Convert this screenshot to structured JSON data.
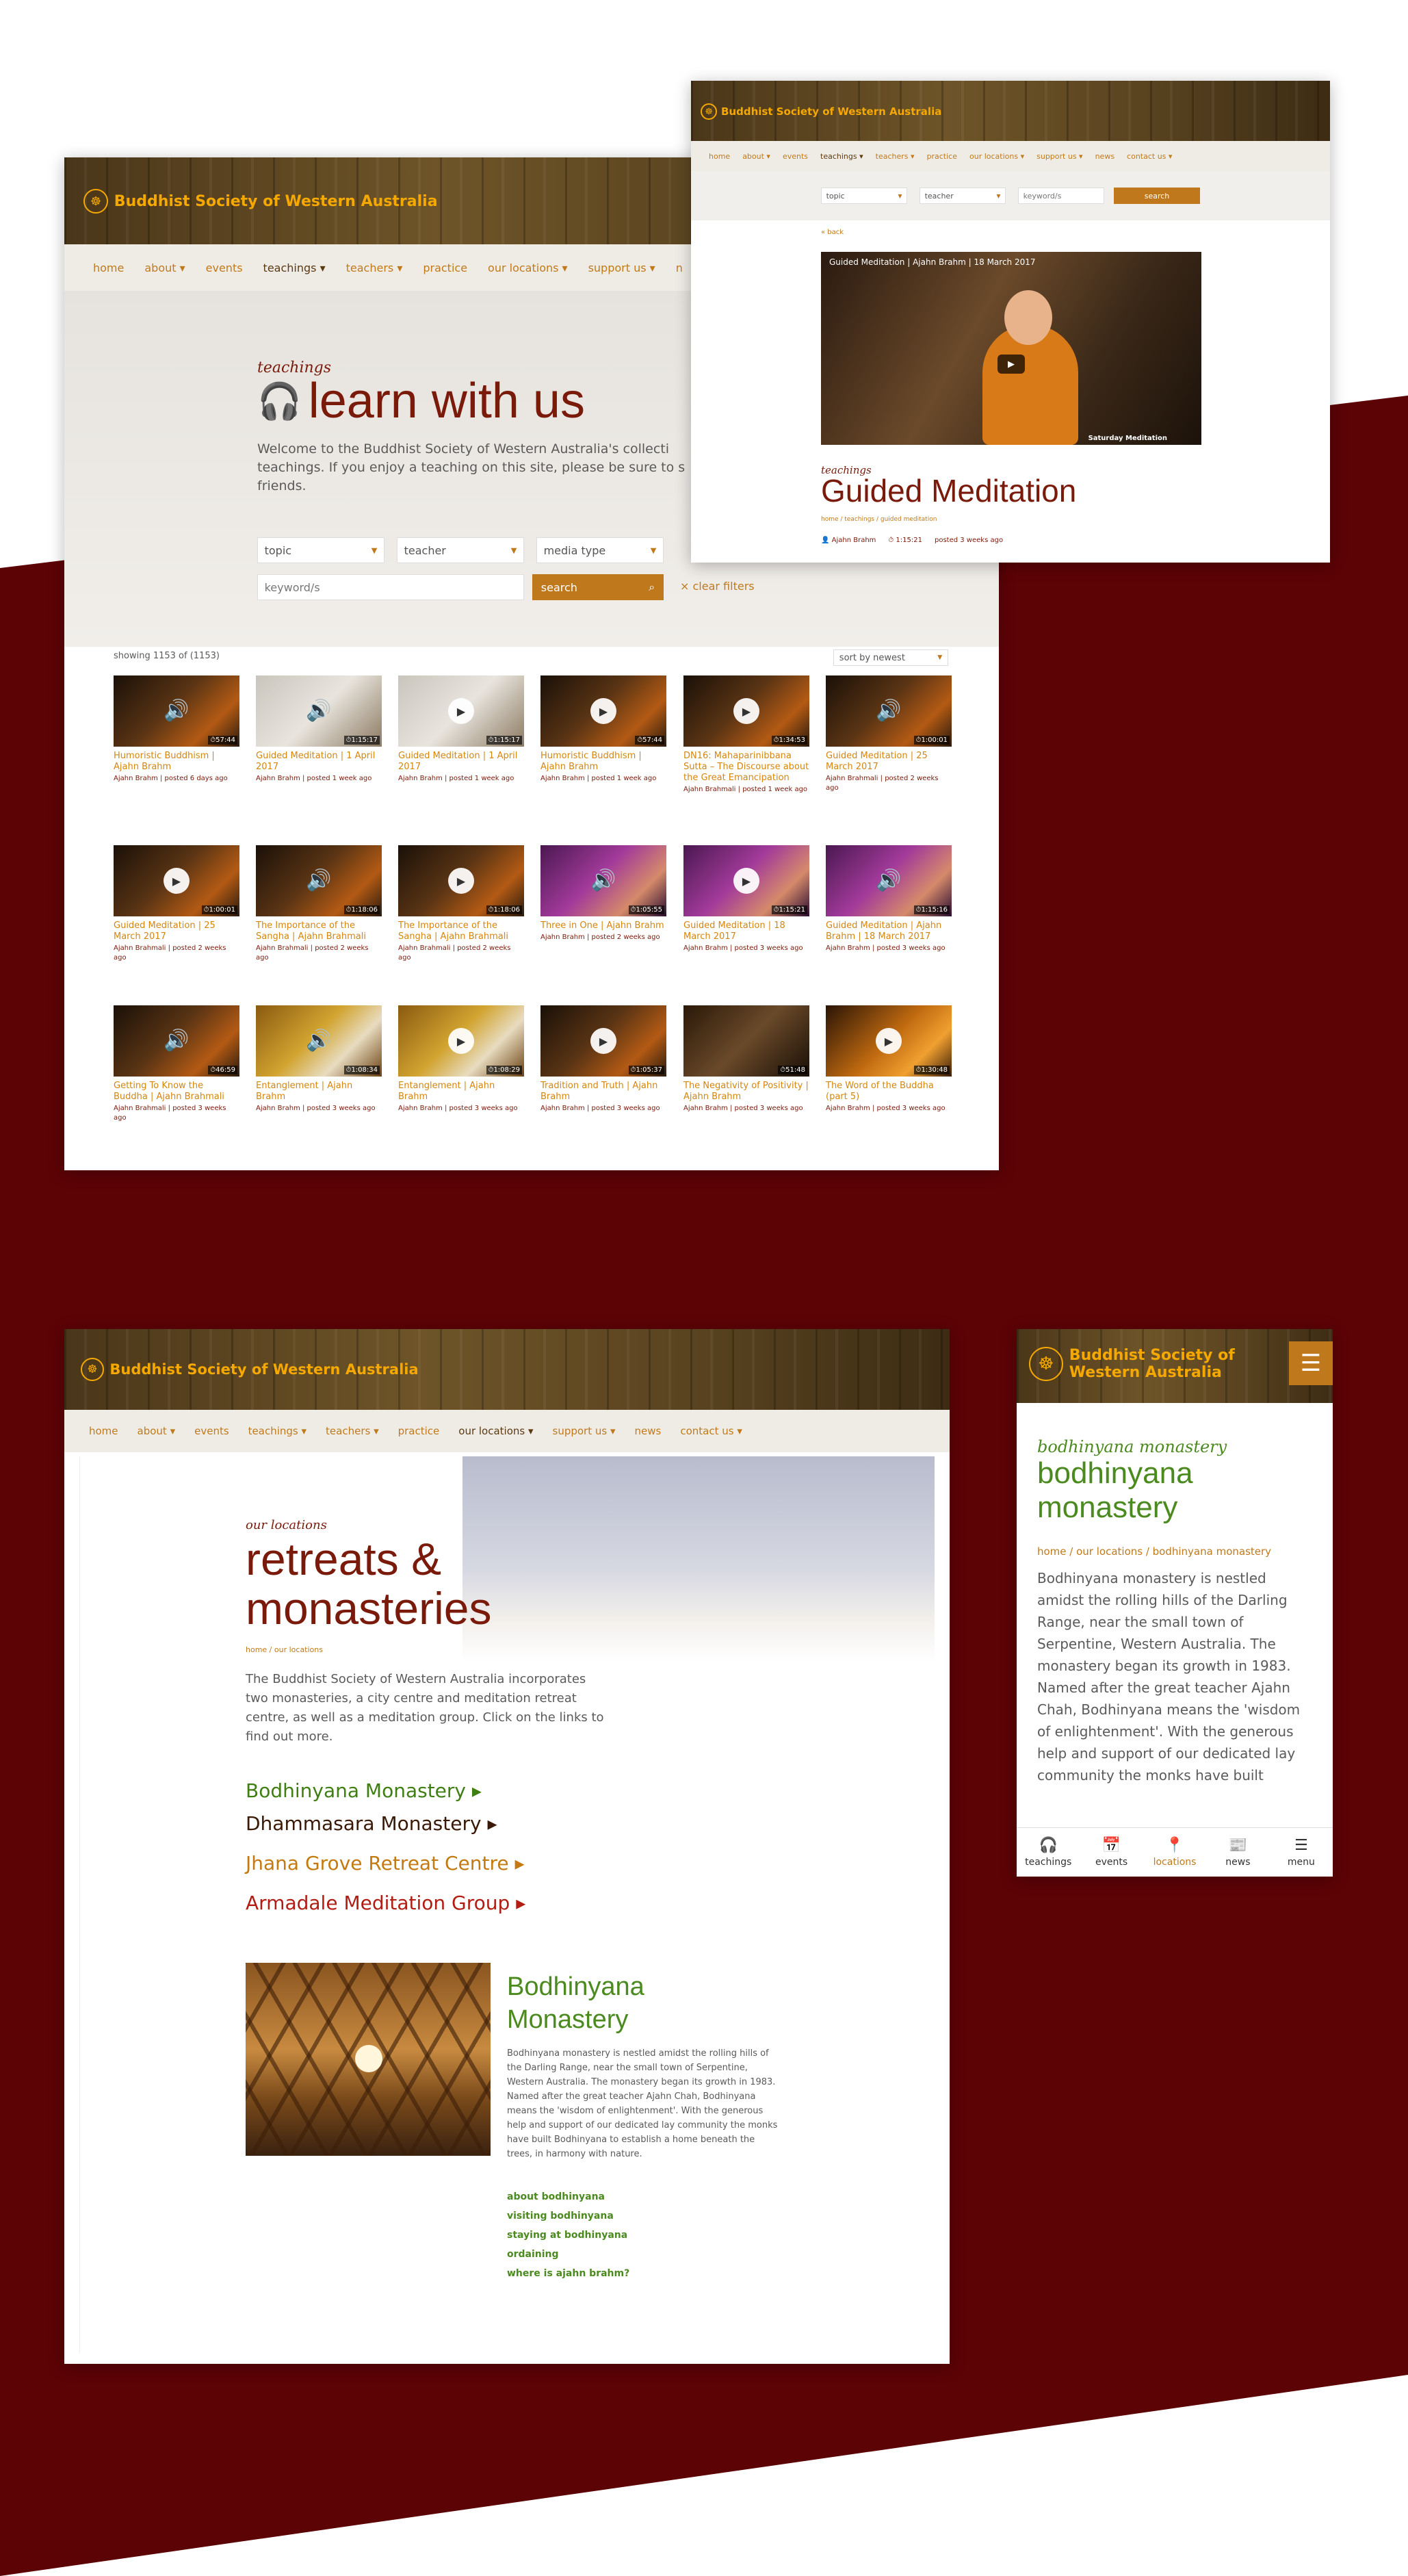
{
  "colors": {
    "maroon": "#5c0306",
    "brand": "#f5a800",
    "accent": "#c07a1c",
    "link_green": "#4b8a1e",
    "title_maroon": "#7a1a0b"
  },
  "site": {
    "name": "Buddhist Society of Western Australia",
    "mobile_name_l1": "Buddhist Society of",
    "mobile_name_l2": "Western Australia"
  },
  "nav_icons": {
    "dropdown": "chevron-down-icon"
  },
  "teachings": {
    "nav": [
      "home",
      "about ▾",
      "events",
      "teachings ▾",
      "teachers ▾",
      "practice",
      "our locations ▾",
      "support us ▾",
      "n"
    ],
    "script_label": "teachings",
    "title": "learn with us",
    "intro": "Welcome to the Buddhist Society of Western Australia's collecti teachings. If you enjoy a teaching on this site, please be sure to s friends.",
    "filters": {
      "topic": "topic",
      "teacher": "teacher",
      "media_type": "media type",
      "keyword_placeholder": "keyword/s",
      "search": "search",
      "clear": "× clear filters"
    },
    "showing": "showing 1153 of (1153)",
    "sort": "sort by newest",
    "cards": [
      {
        "title": "Humoristic Buddhism | Ajahn Brahm",
        "meta": "Ajahn Brahm | posted 6 days ago",
        "dur": "57:44",
        "media": "audio",
        "tone": "dark"
      },
      {
        "title": "Guided Meditation | 1 April 2017",
        "meta": "Ajahn Brahm | posted 1 week ago",
        "dur": "1:15:17",
        "media": "audio",
        "tone": "light"
      },
      {
        "title": "Guided Meditation | 1 April 2017",
        "meta": "Ajahn Brahm | posted 1 week ago",
        "dur": "1:15:17",
        "media": "video",
        "tone": "light"
      },
      {
        "title": "Humoristic Buddhism | Ajahn Brahm",
        "meta": "Ajahn Brahm | posted 1 week ago",
        "dur": "57:44",
        "media": "video",
        "tone": "dark"
      },
      {
        "title": "DN16: Mahaparinibbana Sutta – The Discourse about the Great Emancipation",
        "meta": "Ajahn Brahmali | posted 1 week ago",
        "dur": "1:34:53",
        "media": "video",
        "tone": "dark"
      },
      {
        "title": "Guided Meditation | 25 March 2017",
        "meta": "Ajahn Brahmali | posted 2 weeks ago",
        "dur": "1:00:01",
        "media": "audio",
        "tone": "dark"
      },
      {
        "title": "Guided Meditation | 25 March 2017",
        "meta": "Ajahn Brahmali | posted 2 weeks ago",
        "dur": "1:00:01",
        "media": "video",
        "tone": "dark"
      },
      {
        "title": "The Importance of the Sangha | Ajahn Brahmali",
        "meta": "Ajahn Brahmali | posted 2 weeks ago",
        "dur": "1:18:06",
        "media": "audio",
        "tone": "dark"
      },
      {
        "title": "The Importance of the Sangha | Ajahn Brahmali",
        "meta": "Ajahn Brahmali | posted 2 weeks ago",
        "dur": "1:18:06",
        "media": "video",
        "tone": "dark"
      },
      {
        "title": "Three in One | Ajahn Brahm",
        "meta": "Ajahn Brahm | posted 2 weeks ago",
        "dur": "1:05:55",
        "media": "audio",
        "tone": "purple"
      },
      {
        "title": "Guided Meditation | 18 March 2017",
        "meta": "Ajahn Brahm | posted 3 weeks ago",
        "dur": "1:15:21",
        "media": "video",
        "tone": "purple"
      },
      {
        "title": "Guided Meditation | Ajahn Brahm | 18 March 2017",
        "meta": "Ajahn Brahm | posted 3 weeks ago",
        "dur": "1:15:16",
        "media": "audio",
        "tone": "purple"
      },
      {
        "title": "Getting To Know the Buddha | Ajahn Brahmali",
        "meta": "Ajahn Brahmali | posted 3 weeks ago",
        "dur": "46:59",
        "media": "audio",
        "tone": "dark"
      },
      {
        "title": "Entanglement | Ajahn Brahm",
        "meta": "Ajahn Brahm | posted 3 weeks ago",
        "dur": "1:08:34",
        "media": "audio",
        "tone": "gold"
      },
      {
        "title": "Entanglement | Ajahn Brahm",
        "meta": "Ajahn Brahm | posted 3 weeks ago",
        "dur": "1:08:29",
        "media": "video",
        "tone": "gold"
      },
      {
        "title": "Tradition and Truth | Ajahn Brahm",
        "meta": "Ajahn Brahm | posted 3 weeks ago",
        "dur": "1:05:37",
        "media": "video",
        "tone": "dark"
      },
      {
        "title": "The Negativity of Positivity | Ajahn Brahm",
        "meta": "Ajahn Brahm | posted 3 weeks ago",
        "dur": "51:48",
        "media": "none",
        "tone": "brown"
      },
      {
        "title": "The Word of the Buddha (part 5)",
        "meta": "Ajahn Brahm | posted 3 weeks ago",
        "dur": "1:30:48",
        "media": "video",
        "tone": "orange"
      }
    ]
  },
  "detail": {
    "nav": [
      "home",
      "about ▾",
      "events",
      "teachings ▾",
      "teachers ▾",
      "practice",
      "our locations ▾",
      "support us ▾",
      "news",
      "contact us ▾"
    ],
    "filters": {
      "topic": "topic",
      "teacher": "teacher",
      "keyword_placeholder": "keyword/s",
      "search": "search"
    },
    "back": "« back",
    "video_title": "Guided Meditation | Ajahn Brahm | 18 March 2017",
    "video_caption": "Saturday Meditation",
    "script_label": "teachings",
    "title": "Guided Meditation",
    "breadcrumb": "home / teachings / guided meditation",
    "teacher": "Ajahn Brahm",
    "duration": "1:15:21",
    "posted": "posted 3 weeks ago"
  },
  "locations": {
    "nav": [
      "home",
      "about ▾",
      "events",
      "teachings ▾",
      "teachers ▾",
      "practice",
      "our locations ▾",
      "support us ▾",
      "news",
      "contact us ▾"
    ],
    "script_label": "our locations",
    "title_l1": "retreats &",
    "title_l2": "monasteries",
    "breadcrumb": "home / our locations",
    "intro": "The Buddhist Society of Western Australia incorporates two monasteries, a city centre and meditation retreat centre, as well as a meditation group. Click on the links to find out more.",
    "links": [
      {
        "label": "Bodhinyana Monastery ▸",
        "color": "#3f7f12"
      },
      {
        "label": "Dhammasara Monastery ▸",
        "color": "#3a1a06"
      },
      {
        "label": "Jhana Grove Retreat Centre ▸",
        "color": "#c47a10"
      },
      {
        "label": "Armadale Meditation Group ▸",
        "color": "#b11d12"
      }
    ],
    "feature": {
      "title_l1": "Bodhinyana",
      "title_l2": "Monastery",
      "body": "Bodhinyana monastery is nestled amidst the rolling hills of the Darling Range, near the small town of Serpentine, Western Australia. The monastery began its growth in 1983. Named after the great teacher Ajahn Chah, Bodhinyana means the 'wisdom of enlightenment'. With the generous help and support of our dedicated lay community the monks have built Bodhinyana to establish a home beneath the trees, in harmony with nature.",
      "links": [
        "about bodhinyana",
        "visiting bodhinyana",
        "staying at bodhinyana",
        "ordaining",
        "where is ajahn brahm?"
      ]
    }
  },
  "mobile": {
    "script_label": "bodhinyana monastery",
    "title_l1": "bodhinyana",
    "title_l2": "monastery",
    "breadcrumb": "home / our locations / bodhinyana monastery",
    "body": "Bodhinyana monastery is nestled amidst the rolling hills of the Darling Range, near the small town of Serpentine, Western Australia. The monastery began its growth in 1983. Named after the great teacher Ajahn Chah, Bodhinyana means the 'wisdom of enlightenment'. With the generous help and support of our dedicated lay community the monks have built Bodhinyana to establish a home beneath the trees, in",
    "tabs": [
      {
        "label": "teachings",
        "icon": "headphones-icon",
        "glyph": "🎧"
      },
      {
        "label": "events",
        "icon": "calendar-icon",
        "glyph": "📅"
      },
      {
        "label": "locations",
        "icon": "location-pin-icon",
        "glyph": "📍"
      },
      {
        "label": "news",
        "icon": "newspaper-icon",
        "glyph": "📰"
      },
      {
        "label": "menu",
        "icon": "hamburger-icon",
        "glyph": "☰"
      }
    ]
  }
}
